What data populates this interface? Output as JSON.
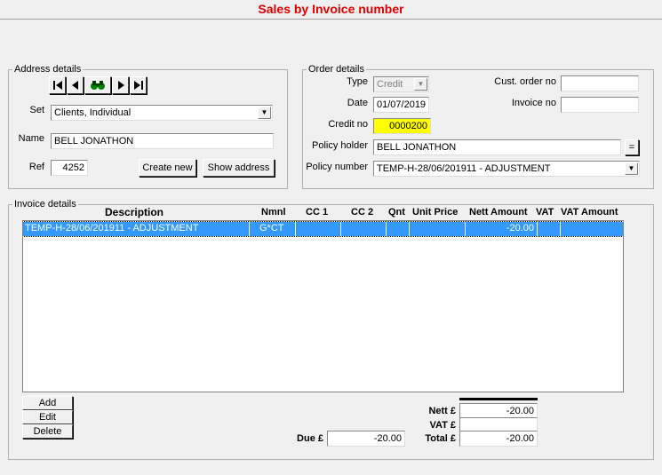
{
  "window": {
    "title": "Sales by Invoice number"
  },
  "address": {
    "legend": "Address details",
    "set_label": "Set",
    "set_value": "Clients, Individual",
    "name_label": "Name",
    "name_value": "BELL JONATHON",
    "ref_label": "Ref",
    "ref_value": "4252",
    "create_new": "Create new",
    "show_address": "Show address"
  },
  "order": {
    "legend": "Order details",
    "type_label": "Type",
    "type_value": "Credit",
    "date_label": "Date",
    "date_value": "01/07/2019",
    "credit_label": "Credit no",
    "credit_value": "0000200",
    "cust_order_label": "Cust. order no",
    "cust_order_value": "",
    "invoice_no_label": "Invoice no",
    "invoice_no_value": "",
    "policy_holder_label": "Policy holder",
    "policy_holder_value": "BELL JONATHON",
    "policy_holder_btn": "=",
    "policy_number_label": "Policy number",
    "policy_number_value": "TEMP-H-28/06/201911 - ADJUSTMENT"
  },
  "invoice": {
    "legend": "Invoice details",
    "columns": {
      "description": "Description",
      "nmnl": "Nmnl",
      "cc1": "CC 1",
      "cc2": "CC 2",
      "qnt": "Qnt",
      "unit_price": "Unit Price",
      "nett_amount": "Nett Amount",
      "vat": "VAT",
      "vat_amount": "VAT Amount"
    },
    "rows": [
      {
        "description": "TEMP-H-28/06/201911 - ADJUSTMENT",
        "nmnl": "G*CT",
        "cc1": "",
        "cc2": "",
        "qnt": "",
        "unit_price": "",
        "nett_amount": "-20.00",
        "vat": "",
        "vat_amount": ""
      }
    ],
    "add": "Add",
    "edit": "Edit",
    "delete": "Delete"
  },
  "totals": {
    "due_label": "Due £",
    "due_value": "-20.00",
    "nett_label": "Nett £",
    "nett_value": "-20.00",
    "vat_label": "VAT £",
    "vat_value": "",
    "total_label": "Total £",
    "total_value": "-20.00"
  },
  "icons": {
    "first": "first-record-icon",
    "prev": "previous-record-icon",
    "find": "binoculars-icon",
    "next": "next-record-icon",
    "last": "last-record-icon"
  }
}
